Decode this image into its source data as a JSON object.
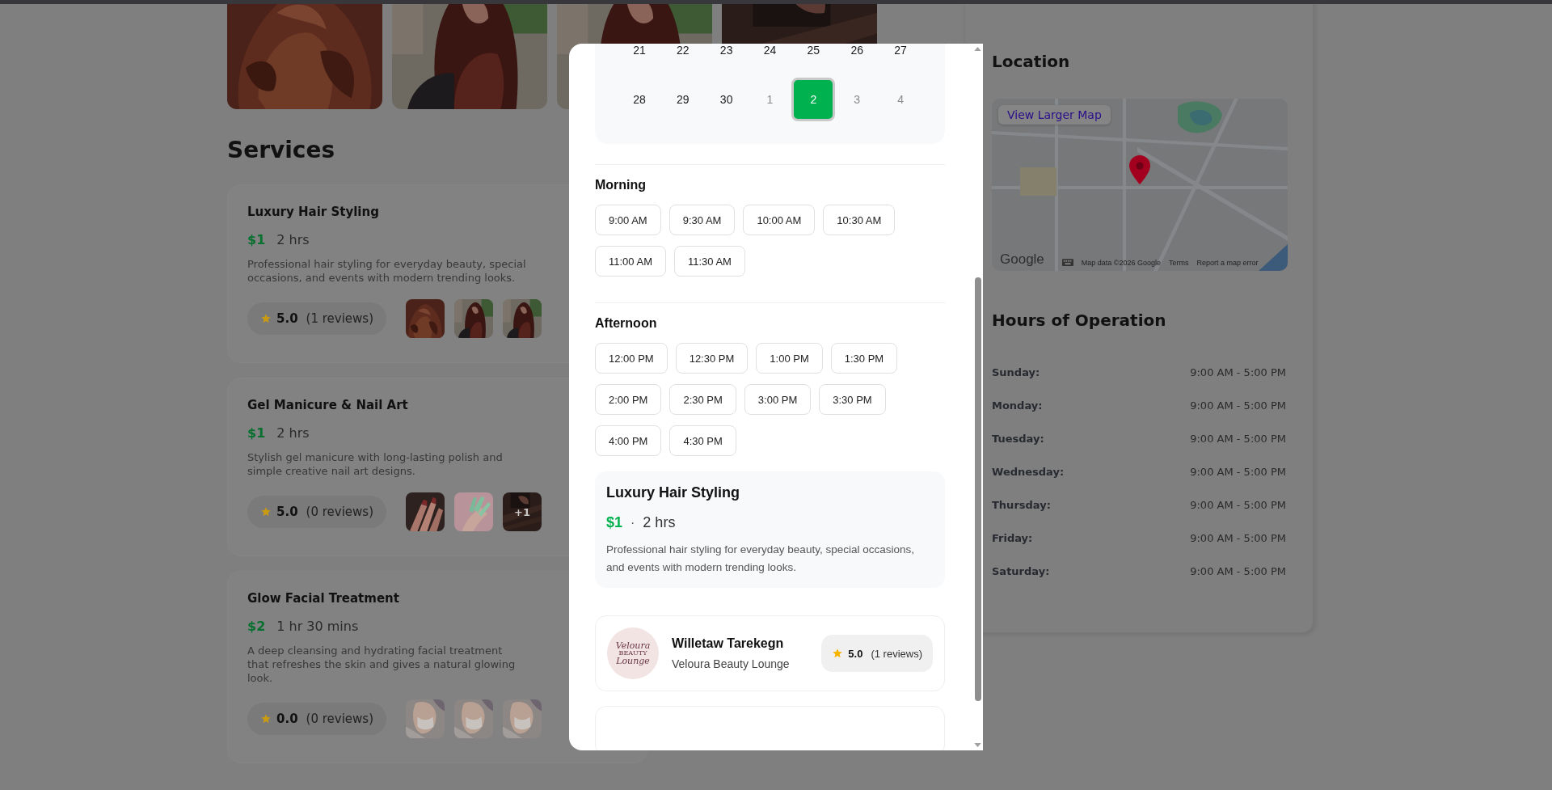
{
  "gallery": [
    {
      "kind": "picture"
    },
    {
      "kind": "picture"
    },
    {
      "kind": "picture"
    },
    {
      "kind": "picture"
    }
  ],
  "services": {
    "title": "Services",
    "items": [
      {
        "name": "Luxury Hair Styling",
        "price": "$1",
        "duration": "2 hrs",
        "description": "Professional hair styling for everyday beauty, special occasions, and events with modern trending looks.",
        "rating": "5.0",
        "reviews": "(1 reviews)",
        "thumbnails": [
          {
            "kind": "picture"
          },
          {
            "kind": "picture"
          },
          {
            "kind": "picture"
          }
        ]
      },
      {
        "name": "Gel Manicure & Nail Art",
        "price": "$1",
        "duration": "2 hrs",
        "description": "Stylish gel manicure with long-lasting polish and simple creative nail art designs.",
        "rating": "5.0",
        "reviews": "(0 reviews)",
        "thumbnails": [
          {
            "kind": "picture"
          },
          {
            "kind": "picture"
          },
          {
            "kind": "picture",
            "overlay": "+1"
          }
        ]
      },
      {
        "name": "Glow Facial Treatment",
        "price": "$2",
        "duration": "1 hr 30 mins",
        "description": "A deep cleansing and hydrating facial treatment that refreshes the skin and gives a natural glowing look.",
        "rating": "0.0",
        "reviews": "(0 reviews)",
        "thumbnails": [
          {
            "kind": "picture"
          },
          {
            "kind": "picture"
          },
          {
            "kind": "picture"
          }
        ]
      }
    ]
  },
  "location": {
    "title": "Location",
    "map": {
      "kind": "picture",
      "link": "View Larger Map",
      "logo": "Google",
      "attribution": "Map data ©2026 Google",
      "terms": "Terms",
      "report": "Report a map error"
    }
  },
  "hours": {
    "title": "Hours of Operation",
    "rows": [
      {
        "day": "Sunday:",
        "time": "9:00 AM - 5:00 PM"
      },
      {
        "day": "Monday:",
        "time": "9:00 AM - 5:00 PM"
      },
      {
        "day": "Tuesday:",
        "time": "9:00 AM - 5:00 PM"
      },
      {
        "day": "Wednesday:",
        "time": "9:00 AM - 5:00 PM"
      },
      {
        "day": "Thursday:",
        "time": "9:00 AM - 5:00 PM"
      },
      {
        "day": "Friday:",
        "time": "9:00 AM - 5:00 PM"
      },
      {
        "day": "Saturday:",
        "time": "9:00 AM - 5:00 PM"
      }
    ]
  },
  "booking": {
    "calendar": {
      "weeks": [
        [
          {
            "label": "21",
            "outside_month": false,
            "selected": false
          },
          {
            "label": "22",
            "outside_month": false,
            "selected": false
          },
          {
            "label": "23",
            "outside_month": false,
            "selected": false
          },
          {
            "label": "24",
            "outside_month": false,
            "selected": false
          },
          {
            "label": "25",
            "outside_month": false,
            "selected": false
          },
          {
            "label": "26",
            "outside_month": false,
            "selected": false
          },
          {
            "label": "27",
            "outside_month": false,
            "selected": false
          }
        ],
        [
          {
            "label": "28",
            "outside_month": false,
            "selected": false
          },
          {
            "label": "29",
            "outside_month": false,
            "selected": false
          },
          {
            "label": "30",
            "outside_month": false,
            "selected": false
          },
          {
            "label": "1",
            "outside_month": true,
            "selected": false
          },
          {
            "label": "2",
            "outside_month": true,
            "selected": true
          },
          {
            "label": "3",
            "outside_month": true,
            "selected": false
          },
          {
            "label": "4",
            "outside_month": true,
            "selected": false
          }
        ]
      ]
    },
    "sections": [
      {
        "title": "Morning",
        "slots": [
          {
            "label": "9:00 AM",
            "selected": false
          },
          {
            "label": "9:30 AM",
            "selected": false
          },
          {
            "label": "10:00 AM",
            "selected": false
          },
          {
            "label": "10:30 AM",
            "selected": false
          },
          {
            "label": "11:00 AM",
            "selected": false
          },
          {
            "label": "11:30 AM",
            "selected": false
          }
        ]
      },
      {
        "title": "Afternoon",
        "slots": [
          {
            "label": "12:00 PM",
            "selected": false
          },
          {
            "label": "12:30 PM",
            "selected": false
          },
          {
            "label": "1:00 PM",
            "selected": false
          },
          {
            "label": "1:30 PM",
            "selected": false
          },
          {
            "label": "2:00 PM",
            "selected": false
          },
          {
            "label": "2:30 PM",
            "selected": false
          },
          {
            "label": "3:00 PM",
            "selected": false
          },
          {
            "label": "3:30 PM",
            "selected": false
          },
          {
            "label": "4:00 PM",
            "selected": false
          },
          {
            "label": "4:30 PM",
            "selected": false
          }
        ]
      }
    ],
    "summary": {
      "name": "Luxury Hair Styling",
      "price": "$1",
      "separator": "·",
      "duration": "2 hrs",
      "description": "Professional hair styling for everyday beauty, special occasions, and events with modern trending looks."
    },
    "provider": {
      "logo": {
        "top": "Veloura",
        "middle": "BEAUTY",
        "bottom": "Lounge"
      },
      "name": "Willetaw Tarekegn",
      "business": "Veloura Beauty Lounge",
      "rating": "5.0",
      "reviews": "(1 reviews)"
    }
  }
}
